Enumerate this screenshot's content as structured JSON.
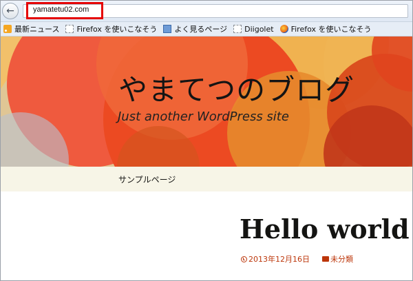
{
  "browser": {
    "url": "yamatetu02.com",
    "back_icon": "back-arrow-icon",
    "bookmarks": [
      {
        "label": "最新ニュース",
        "icon": "rss-icon"
      },
      {
        "label": "Firefox を使いこなそう",
        "icon": "page-icon"
      },
      {
        "label": "よく見るページ",
        "icon": "image-icon"
      },
      {
        "label": "Diigolet",
        "icon": "page-icon"
      },
      {
        "label": "Firefox を使いこなそう",
        "icon": "firefox-icon"
      }
    ]
  },
  "site": {
    "title": "やまてつのブログ",
    "tagline": "Just another WordPress site",
    "nav": [
      "サンプルページ"
    ]
  },
  "post": {
    "title": "Hello world!",
    "date": "2013年12月16日",
    "category": "未分類"
  },
  "colors": {
    "accent": "#bc360a",
    "nav_bg": "#f7f5e7",
    "url_highlight": "#e50000"
  }
}
